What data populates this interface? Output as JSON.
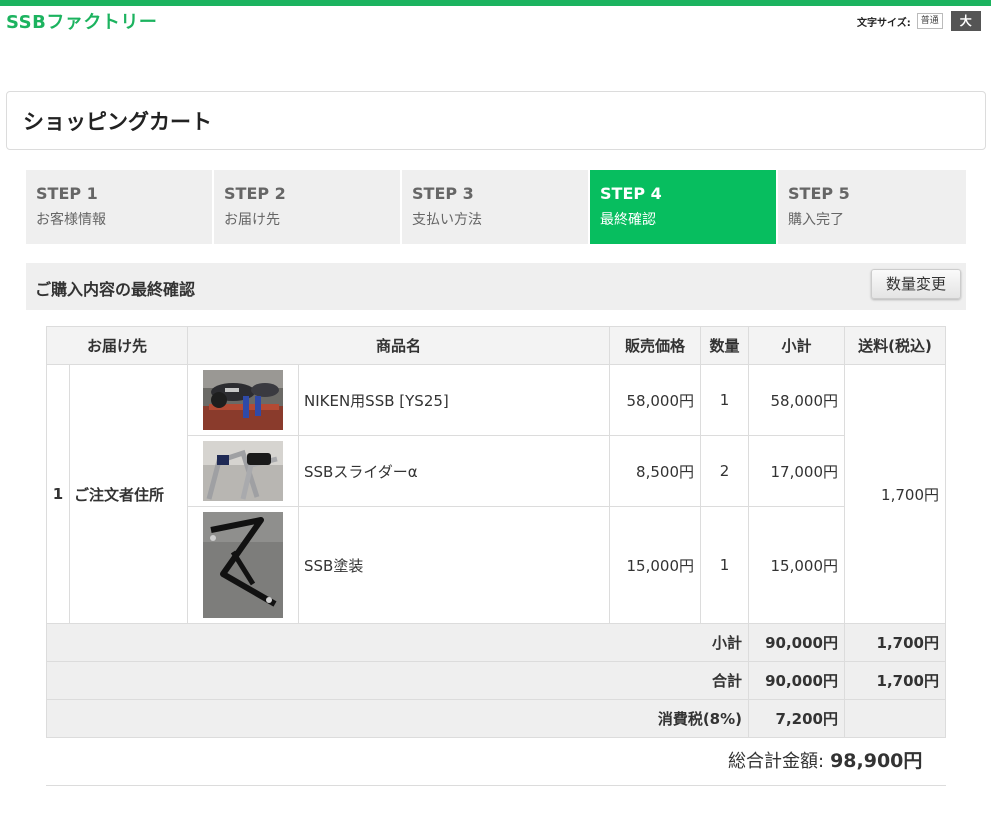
{
  "header": {
    "logo": "SSBファクトリー",
    "font_size_label": "文字サイズ:",
    "font_normal": "普通",
    "font_large": "大"
  },
  "page_title": "ショッピングカート",
  "steps": [
    {
      "num": "STEP 1",
      "name": "お客様情報"
    },
    {
      "num": "STEP 2",
      "name": "お届け先"
    },
    {
      "num": "STEP 3",
      "name": "支払い方法"
    },
    {
      "num": "STEP 4",
      "name": "最終確認"
    },
    {
      "num": "STEP 5",
      "name": "購入完了"
    }
  ],
  "active_step": 4,
  "section": {
    "title": "ご購入内容の最終確認",
    "change_qty_button": "数量変更"
  },
  "table": {
    "headers": {
      "dest": "お届け先",
      "product": "商品名",
      "price": "販売価格",
      "qty": "数量",
      "subtotal": "小計",
      "shipping": "送料(税込)"
    },
    "row_no": "1",
    "destination": "ご注文者住所",
    "items": [
      {
        "name": "NIKEN用SSB [YS25]",
        "price": "58,000円",
        "qty": "1",
        "subtotal": "58,000円",
        "image": "motorcycle-photo"
      },
      {
        "name": "SSBスライダーα",
        "price": "8,500円",
        "qty": "2",
        "subtotal": "17,000円",
        "image": "slider-photo"
      },
      {
        "name": "SSB塗装",
        "price": "15,000円",
        "qty": "1",
        "subtotal": "15,000円",
        "image": "black-bracket-photo"
      }
    ],
    "shipping_fee": "1,700円",
    "summary": {
      "subtotal_label": "小計",
      "subtotal_value": "90,000円",
      "subtotal_shipping": "1,700円",
      "total_label": "合計",
      "total_value": "90,000円",
      "total_shipping": "1,700円",
      "tax_label": "消費税(8%)",
      "tax_value": "7,200円"
    }
  },
  "grand_total": {
    "label": "総合計金額:",
    "value": "98,900円"
  },
  "colors": {
    "brand_green": "#1cb35f",
    "active_step_green": "#07be5f"
  }
}
